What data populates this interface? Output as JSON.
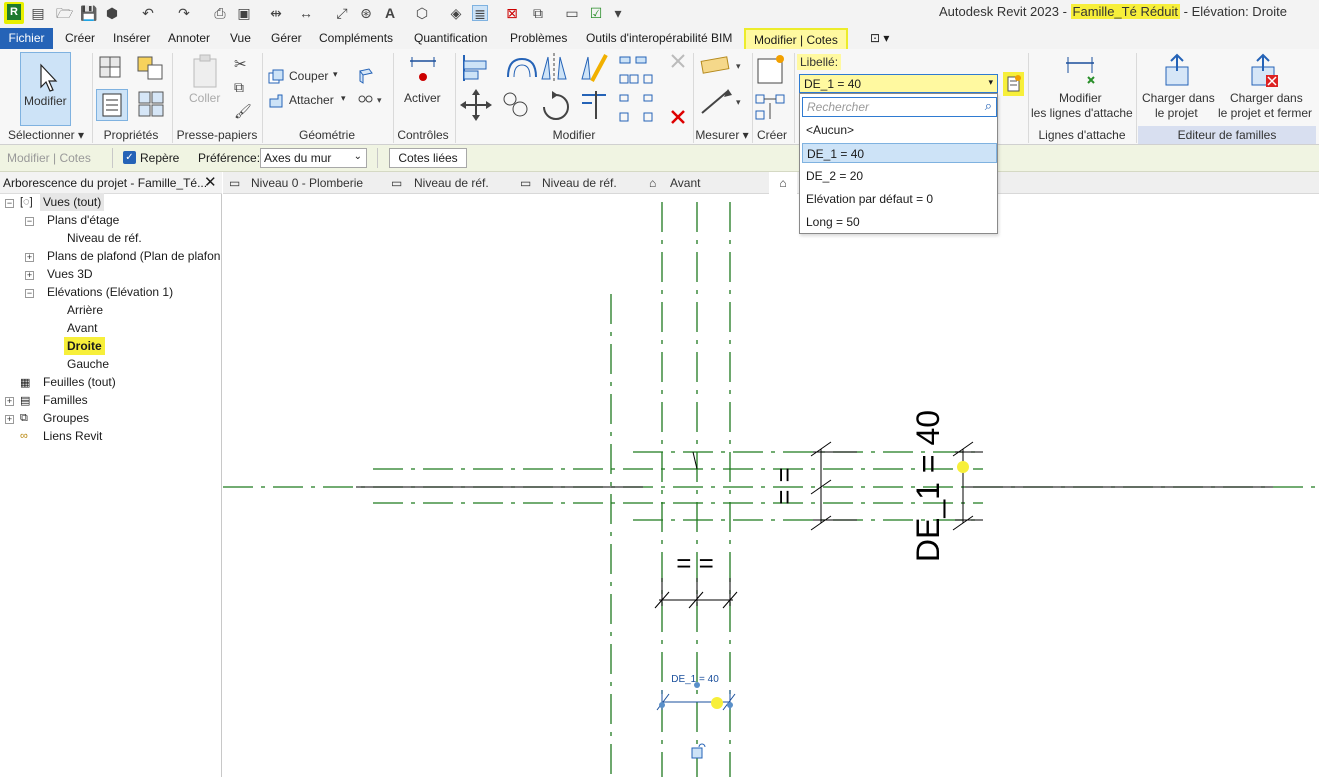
{
  "title_bar": {
    "app": "Autodesk Revit 2023 -",
    "document": "Famille_Té Réduit",
    "view": "- Elévation: Droite"
  },
  "logo_letter": "R",
  "menu_tabs": [
    "Fichier",
    "Créer",
    "Insérer",
    "Annoter",
    "Vue",
    "Gérer",
    "Compléments",
    "Quantification",
    "Problèmes",
    "Outils d'interopérabilité BIM",
    "Modifier | Cotes"
  ],
  "ribbon": {
    "modifier_label": "Modifier",
    "coller_label": "Coller",
    "couper_label": "Couper",
    "attacher_label": "Attacher",
    "activer_label": "Activer",
    "libelle_label": "Libellé:",
    "libelle_value": "DE_1 = 40",
    "modifier_lignes_label_1": "Modifier",
    "modifier_lignes_label_2": "les lignes d'attache",
    "charger_label_1": "Charger dans",
    "charger_label_2": "le projet",
    "charger_fermer_label_1": "Charger dans",
    "charger_fermer_label_2": "le projet et fermer",
    "panels": {
      "selectionner": "Sélectionner ▾",
      "proprietes": "Propriétés",
      "presse_papiers": "Presse-papiers",
      "geometrie": "Géométrie",
      "controles": "Contrôles",
      "modifier": "Modifier",
      "mesurer": "Mesurer ▾",
      "creer": "Créer",
      "lignes_attache": "Lignes d'attache",
      "editeur_familles": "Editeur de familles"
    }
  },
  "options_bar": {
    "context": "Modifier | Cotes",
    "repere_label": "Repère",
    "repere_checked": true,
    "preference_label": "Préférence:",
    "preference_value": "Axes du mur",
    "cotes_liees": "Cotes liées"
  },
  "dropdown": {
    "search_placeholder": "Rechercher",
    "items": [
      "<Aucun>",
      "DE_1 = 40",
      "DE_2 = 20",
      "Elévation par défaut = 0",
      "Long = 50"
    ],
    "selected_index": 1
  },
  "browser": {
    "title": "Arborescence du projet - Famille_Té...",
    "items": [
      {
        "label": "Vues (tout)"
      },
      {
        "label": "Plans d'étage"
      },
      {
        "label": "Niveau de réf."
      },
      {
        "label": "Plans de plafond (Plan de plafon"
      },
      {
        "label": "Vues 3D"
      },
      {
        "label": "Elévations (Elévation 1)"
      },
      {
        "label": "Arrière"
      },
      {
        "label": "Avant"
      },
      {
        "label": "Droite"
      },
      {
        "label": "Gauche"
      },
      {
        "label": "Feuilles (tout)"
      },
      {
        "label": "Familles"
      },
      {
        "label": "Groupes"
      },
      {
        "label": "Liens Revit"
      }
    ]
  },
  "view_tabs": [
    "Niveau 0 - Plomberie",
    "Niveau de réf.",
    "Niveau de réf.",
    "Avant"
  ],
  "canvas": {
    "eq_vertical": "= =",
    "eq_horizontal": "= =",
    "big_dimension": "DE_1 = 40",
    "small_dimension": "DE_1 = 40"
  },
  "colors": {
    "file_tab": "#2563b7",
    "highlight": "#f7ef3a",
    "ref_line": "#1f7a1f",
    "dimension": "#1a4f9c"
  }
}
